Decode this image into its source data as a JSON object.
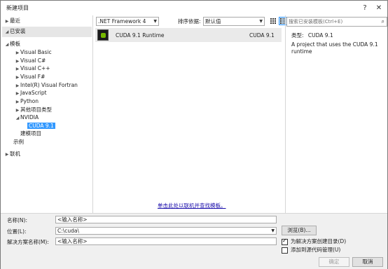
{
  "window": {
    "title": "新建项目",
    "help_glyph": "?",
    "close_glyph": "✕"
  },
  "tree": {
    "recent": "最近",
    "installed": "已安装",
    "templates": "模板",
    "items": [
      {
        "label": "Visual Basic"
      },
      {
        "label": "Visual C#"
      },
      {
        "label": "Visual C++"
      },
      {
        "label": "Visual F#"
      },
      {
        "label": "Intel(R) Visual Fortran"
      },
      {
        "label": "JavaScript"
      },
      {
        "label": "Python"
      },
      {
        "label": "其他项目类型"
      },
      {
        "label": "NVIDIA"
      }
    ],
    "cuda": "CUDA 9.1",
    "build_projects": "建模项目",
    "samples": "示例",
    "online": "联机"
  },
  "toolbar": {
    "framework": ".NET Framework 4",
    "sort_label": "排序依据:",
    "sort_value": "默认值"
  },
  "templates_list": [
    {
      "name": "CUDA 9.1 Runtime",
      "language": "CUDA 9.1"
    }
  ],
  "online_link": "单击此处以联机并查找模板。",
  "right": {
    "search_placeholder": "搜索已安装模板(Ctrl+E)",
    "type_label": "类型:",
    "type_value": "CUDA 9.1",
    "description": "A project that uses the CUDA 9.1 runtime"
  },
  "form": {
    "name_label": "名称(N):",
    "name_value": "<输入名称>",
    "location_label": "位置(L):",
    "location_value": "C:\\cuda\\",
    "solution_label": "解决方案名称(M):",
    "solution_value": "<输入名称>",
    "browse": "浏览(B)...",
    "create_dir": "为解决方案创建目录(D)",
    "add_source_control": "添加到源代码管理(U)",
    "ok": "确定",
    "cancel": "取消"
  },
  "colors": {
    "selection": "#3399ff",
    "link": "#1a0dab",
    "nvidia_green": "#76b900"
  }
}
